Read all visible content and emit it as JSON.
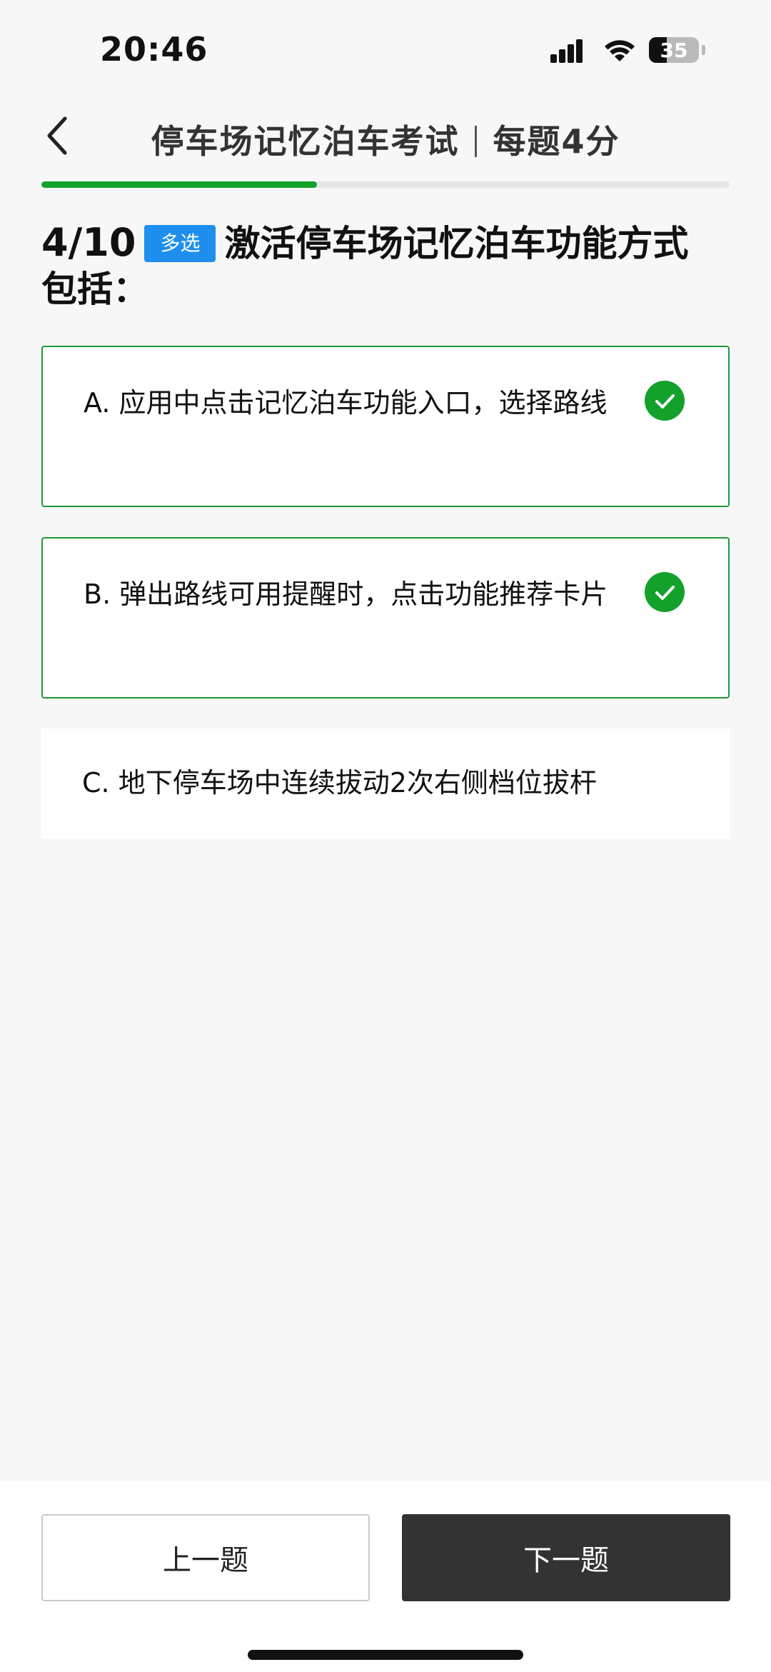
{
  "status_bar": {
    "time": "20:46",
    "battery_level": "35",
    "icons": [
      "signal-icon",
      "wifi-icon",
      "battery-icon"
    ]
  },
  "header": {
    "title": "停车场记忆泊车考试",
    "score": "每题4分",
    "back_icon": "chevron-left-icon"
  },
  "progress": {
    "current": 4,
    "total": 10,
    "fraction": 0.4
  },
  "question": {
    "number": "4/10",
    "type": "多选",
    "text": "激活停车场记忆泊车功能方式包括："
  },
  "options": [
    {
      "label": "A. 应用中点击记忆泊车功能入口，选择路线",
      "selected": true
    },
    {
      "label": "B. 弹出路线可用提醒时，点击功能推荐卡片",
      "selected": true
    },
    {
      "label": "C. 地下停车场中连续拔动2次右侧档位拔杆",
      "selected": false
    }
  ],
  "footer": {
    "prev_label": "上一题",
    "next_label": "下一题"
  },
  "colors": {
    "accent_green": "#13a12b",
    "tag_blue": "#1e8fee",
    "next_button": "#333333"
  }
}
